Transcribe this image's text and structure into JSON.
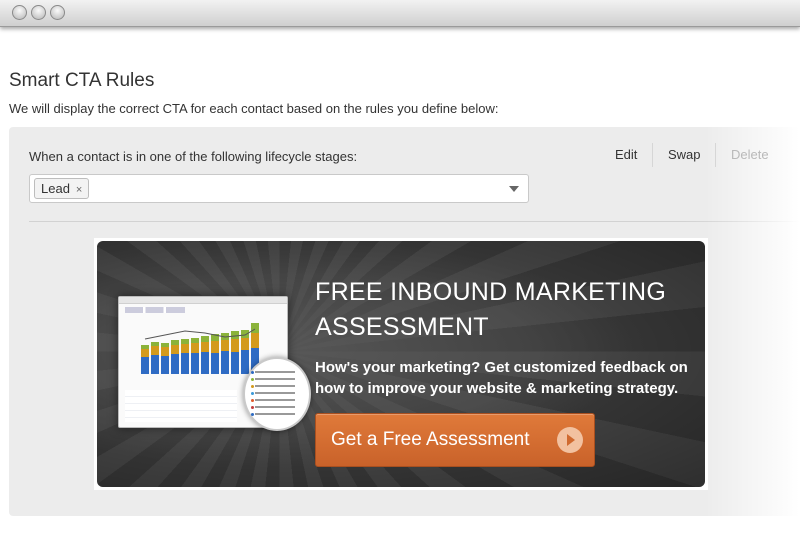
{
  "page": {
    "title": "Smart CTA Rules",
    "subtitle": "We will display the correct CTA for each contact based on the rules you define below:"
  },
  "rule": {
    "label": "When a contact is in one of the following lifecycle stages:",
    "actions": {
      "edit": "Edit",
      "swap": "Swap",
      "delete": "Delete"
    },
    "selected_stages": [
      {
        "label": "Lead",
        "remove": "×"
      }
    ]
  },
  "cta": {
    "headline": "FREE INBOUND MARKETING ASSESSMENT",
    "body": "How's your marketing? Get customized feedback on how to improve your website & marketing strategy.",
    "button_label": "Get a Free Assessment",
    "button_color": "#d66f30",
    "background_color": "#3d3d3d"
  },
  "colors": {
    "panel_bg": "#ececec",
    "delete_disabled": "#b9b9b9"
  }
}
